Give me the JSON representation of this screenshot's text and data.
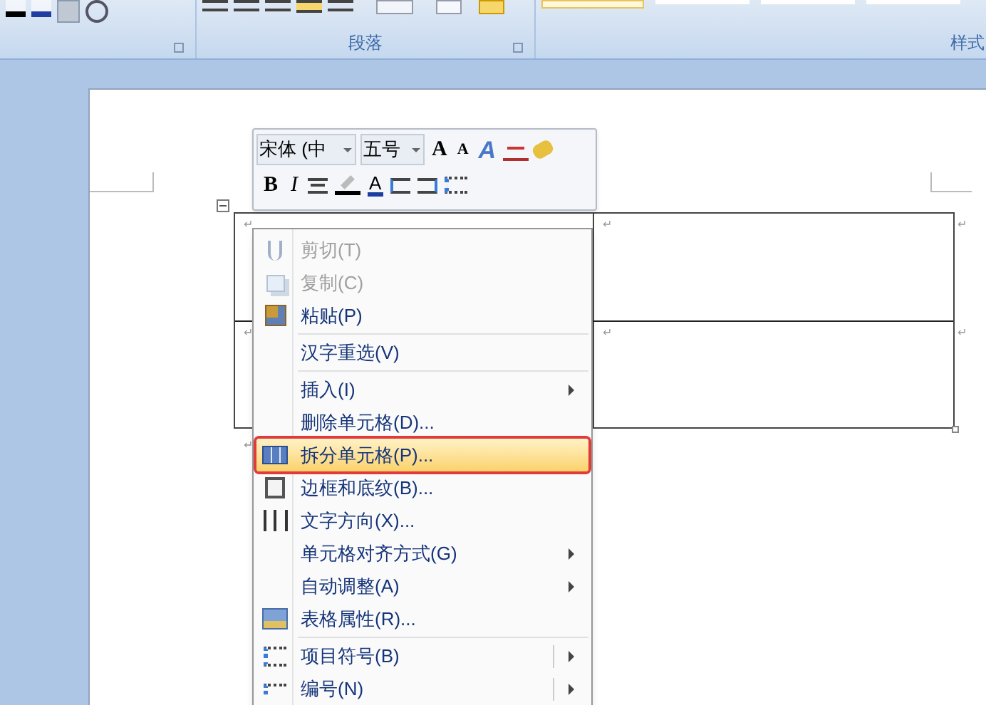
{
  "ribbon": {
    "groups": [
      {
        "label": "段落"
      },
      {
        "label": "样式"
      }
    ]
  },
  "mini_toolbar": {
    "font": "宋体 (中",
    "size": "五号",
    "row1": [
      {
        "kind": "grow",
        "label": "A"
      },
      {
        "kind": "shrink",
        "label": "A"
      },
      {
        "kind": "effects",
        "label": "A"
      },
      {
        "kind": "phonetic"
      },
      {
        "kind": "painter"
      }
    ],
    "row2": [
      {
        "kind": "bold",
        "label": "B"
      },
      {
        "kind": "italic",
        "label": "I"
      },
      {
        "kind": "center"
      },
      {
        "kind": "highlight"
      },
      {
        "kind": "fontcolor",
        "label": "A"
      },
      {
        "kind": "outdent"
      },
      {
        "kind": "indent"
      },
      {
        "kind": "bullets"
      }
    ]
  },
  "table": {
    "rows": [
      {
        "cells": [
          "↵",
          "↵"
        ],
        "end": "↵"
      },
      {
        "cells": [
          "↵",
          "↵"
        ],
        "end": "↵"
      }
    ],
    "after": "↵"
  },
  "context_menu": {
    "items": [
      {
        "kind": "cut",
        "label": "剪切(T)",
        "disabled": true,
        "selected": false,
        "submenu": false
      },
      {
        "kind": "copy",
        "label": "复制(C)",
        "disabled": true,
        "selected": false,
        "submenu": false
      },
      {
        "kind": "paste",
        "label": "粘贴(P)",
        "disabled": false,
        "selected": false,
        "submenu": false
      },
      {
        "kind": "separator"
      },
      {
        "kind": "item",
        "label": "汉字重选(V)",
        "disabled": false,
        "selected": false,
        "submenu": false
      },
      {
        "kind": "separator"
      },
      {
        "kind": "item",
        "label": "插入(I)",
        "disabled": false,
        "selected": false,
        "submenu": true
      },
      {
        "kind": "item",
        "label": "删除单元格(D)...",
        "disabled": false,
        "selected": false,
        "submenu": false
      },
      {
        "kind": "split",
        "label": "拆分单元格(P)...",
        "disabled": false,
        "selected": true,
        "submenu": false
      },
      {
        "kind": "border",
        "label": "边框和底纹(B)...",
        "disabled": false,
        "selected": false,
        "submenu": false
      },
      {
        "kind": "direction",
        "label": "文字方向(X)...",
        "disabled": false,
        "selected": false,
        "submenu": false
      },
      {
        "kind": "item",
        "label": "单元格对齐方式(G)",
        "disabled": false,
        "selected": false,
        "submenu": true
      },
      {
        "kind": "item",
        "label": "自动调整(A)",
        "disabled": false,
        "selected": false,
        "submenu": true
      },
      {
        "kind": "properties",
        "label": "表格属性(R)...",
        "disabled": false,
        "selected": false,
        "submenu": false
      },
      {
        "kind": "separator"
      },
      {
        "kind": "bullets",
        "label": "项目符号(B)",
        "disabled": false,
        "selected": false,
        "submenu": true
      },
      {
        "kind": "numbering",
        "label": "编号(N)",
        "disabled": false,
        "selected": false,
        "submenu": true
      }
    ]
  }
}
